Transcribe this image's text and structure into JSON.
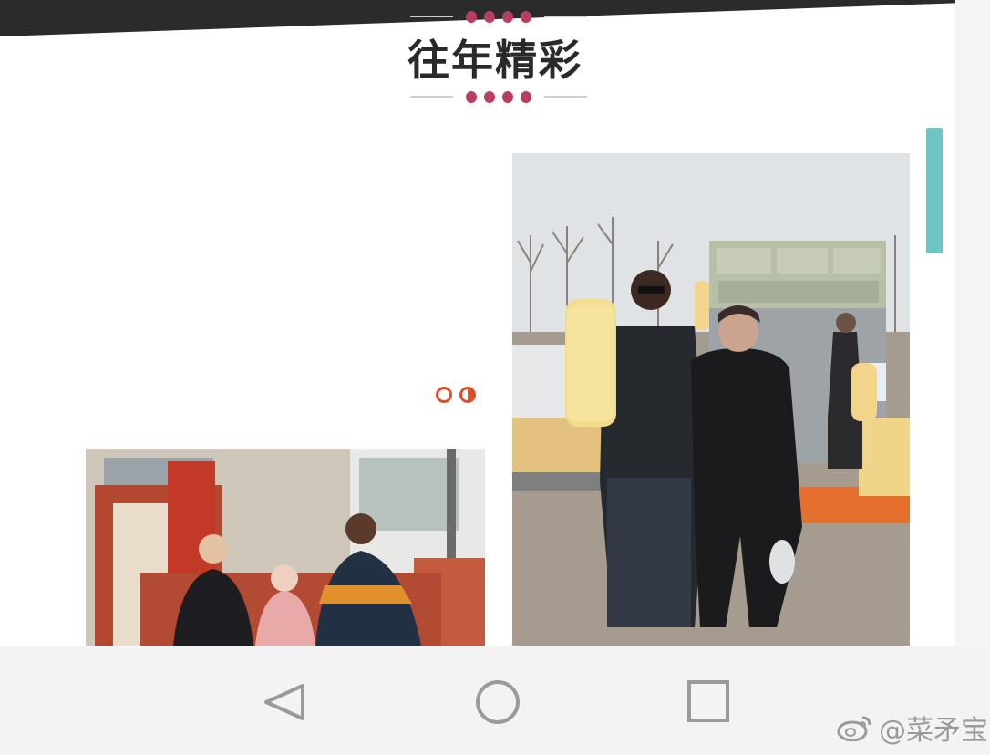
{
  "section": {
    "title": "往年精彩"
  },
  "carousel": {
    "page_count": 2,
    "active_index": 1
  },
  "navbar": {
    "buttons": [
      "back-icon",
      "home-icon",
      "recents-icon"
    ]
  },
  "watermark": {
    "text": "@菜矛宝"
  },
  "colors": {
    "accent_dots": "#b93d5c",
    "pager": "#d9512c",
    "scroll_indicator": "#6fc4c4",
    "nav_icon": "#9a9a9a"
  }
}
